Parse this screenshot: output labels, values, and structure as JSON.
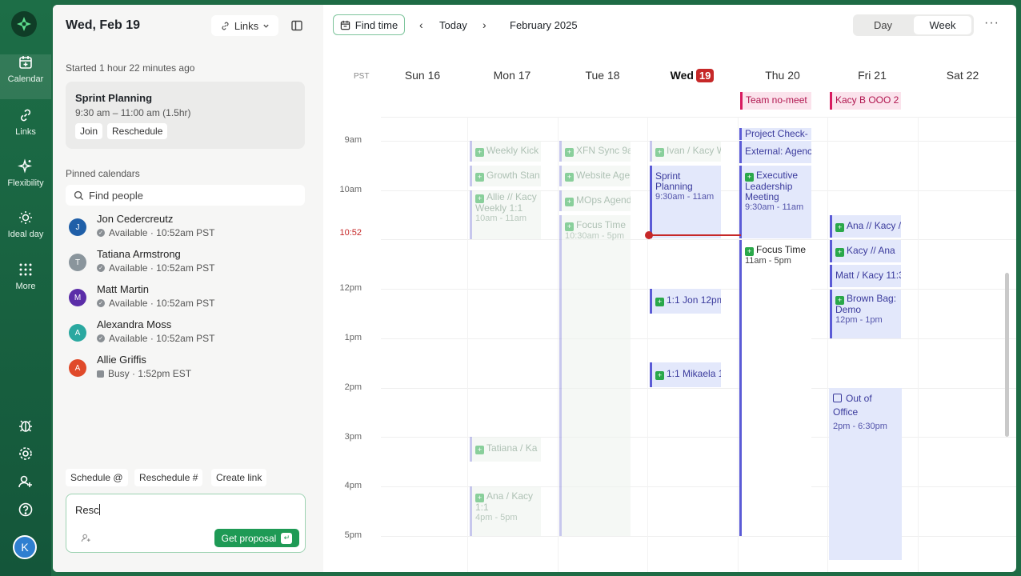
{
  "rail": {
    "items": [
      {
        "label": "Calendar",
        "icon": "calendar-plus-icon"
      },
      {
        "label": "Links",
        "icon": "link-icon"
      },
      {
        "label": "Flexibility",
        "icon": "sparkle-icon"
      },
      {
        "label": "Ideal day",
        "icon": "sun-icon"
      },
      {
        "label": "More",
        "icon": "grid-icon"
      }
    ],
    "user_initial": "K"
  },
  "left": {
    "date": "Wed, Feb 19",
    "links_label": "Links",
    "started": "Started 1 hour 22 minutes ago",
    "meeting": {
      "title": "Sprint Planning",
      "time": "9:30 am – 11:00 am (1.5hr)",
      "join": "Join",
      "reschedule": "Reschedule"
    },
    "pinned_heading": "Pinned calendars",
    "find_people_placeholder": "Find people",
    "people": [
      {
        "initial": "J",
        "name": "Jon Cedercreutz",
        "status": "Available · 10:52am PST",
        "color": "#1f5fa8"
      },
      {
        "initial": "T",
        "name": "Tatiana Armstrong",
        "status": "Available · 10:52am PST",
        "color": "#8a959c"
      },
      {
        "initial": "M",
        "name": "Matt Martin",
        "status": "Available · 10:52am PST",
        "color": "#5b2da8"
      },
      {
        "initial": "A",
        "name": "Alexandra Moss",
        "status": "Available · 10:52am PST",
        "color": "#2aa8a0"
      },
      {
        "initial": "A",
        "name": "Allie Griffis",
        "status": "Busy · 1:52pm EST",
        "color": "#e04a2a"
      }
    ],
    "chips": [
      "Schedule @",
      "Reschedule #",
      "Create link"
    ],
    "compose_text": "Resc",
    "get_proposal": "Get proposal"
  },
  "calendar": {
    "find_time": "Find time",
    "today": "Today",
    "month": "February 2025",
    "view_day": "Day",
    "view_week": "Week",
    "timezone": "PST",
    "days": [
      {
        "name": "Sun 16"
      },
      {
        "name": "Mon 17"
      },
      {
        "name": "Tue 18"
      },
      {
        "name": "Wed",
        "badge": "19"
      },
      {
        "name": "Thu 20"
      },
      {
        "name": "Fri 21"
      },
      {
        "name": "Sat 22"
      }
    ],
    "hours": [
      "9am",
      "10am",
      "11am",
      "12pm",
      "1pm",
      "2pm",
      "3pm",
      "4pm",
      "5pm"
    ],
    "now_label": "10:52",
    "events": {
      "thu_allday": "Team no-meet",
      "fri_allday": "Kacy B OOO 2",
      "mon_weekly_kick": "Weekly Kick",
      "mon_growth": "Growth Stan",
      "mon_allie_title": "Allie // Kacy Weekly 1:1",
      "mon_allie_time": "10am - 11am",
      "mon_tatiana": "Tatiana / Ka",
      "mon_ana_title": "Ana / Kacy 1:1",
      "mon_ana_time": "4pm - 5pm",
      "tue_xfn": "XFN Sync 9a",
      "tue_website": "Website Age",
      "tue_mops": "MOps Agend",
      "tue_focus_title": "Focus Time",
      "tue_focus_time": "10:30am - 5pm",
      "wed_ivan": "Ivan / Kacy W",
      "wed_sprint_title": "Sprint Planning",
      "wed_sprint_time": "9:30am - 11am",
      "wed_jon": "1:1 Jon 12pm",
      "wed_mikaela": "1:1 Mikaela 1",
      "thu_project": "Project Check-",
      "thu_external": "External: Agenc",
      "thu_exec_title": "Executive Leadership Meeting",
      "thu_exec_time": "9:30am - 11am",
      "thu_focus_title": "Focus Time",
      "thu_focus_time": "11am - 5pm",
      "fri_ana": "Ana // Kacy /",
      "fri_kacy": "Kacy // Ana",
      "fri_matt": "Matt / Kacy 11:3",
      "fri_brown_title": "Brown Bag: Demo",
      "fri_brown_time": "12pm - 1pm",
      "fri_ooo_title": "Out of Office",
      "fri_ooo_time": "2pm - 6:30pm"
    }
  }
}
